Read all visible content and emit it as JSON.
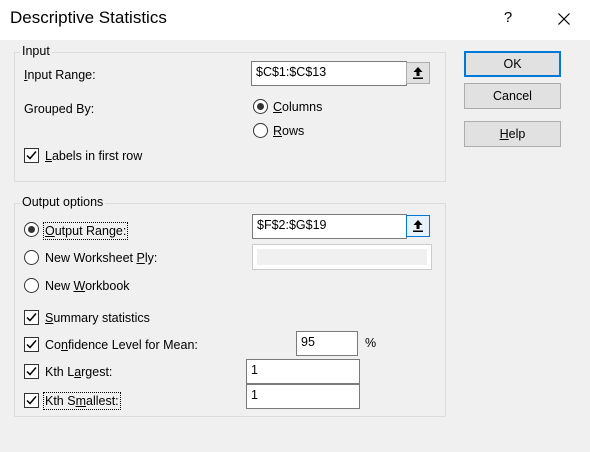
{
  "window": {
    "title": "Descriptive Statistics",
    "help_glyph": "?"
  },
  "input_group": {
    "legend": "Input",
    "input_range": {
      "label_pre": "",
      "label_ul": "I",
      "label_post": "nput Range:",
      "value": "$C$1:$C$13"
    },
    "grouped_by": {
      "label": "Grouped By:"
    },
    "columns": {
      "label_ul": "C",
      "label_post": "olumns",
      "selected": true
    },
    "rows": {
      "label_ul": "R",
      "label_post": "ows",
      "selected": false
    },
    "labels_first_row": {
      "label_ul": "L",
      "label_post": "abels in first row",
      "checked": true
    }
  },
  "output_group": {
    "legend": "Output options",
    "output_range": {
      "label_ul": "O",
      "label_post": "utput Range:",
      "value": "$F$2:$G$19",
      "selected": true
    },
    "new_worksheet": {
      "label_pre": "New Worksheet ",
      "label_ul": "P",
      "label_post": "ly:",
      "selected": false,
      "value": ""
    },
    "new_workbook": {
      "label_pre": "New ",
      "label_ul": "W",
      "label_post": "orkbook",
      "selected": false
    },
    "summary_statistics": {
      "label_ul": "S",
      "label_post": "ummary statistics",
      "checked": true
    },
    "confidence_level": {
      "label_pre": "Co",
      "label_ul": "n",
      "label_post": "fidence Level for Mean:",
      "checked": true,
      "value": "95",
      "unit": "%"
    },
    "kth_largest": {
      "label_pre": "Kth L",
      "label_ul": "a",
      "label_post": "rgest:",
      "checked": true,
      "value": "1"
    },
    "kth_smallest": {
      "label_pre": "Kth S",
      "label_ul": "m",
      "label_post": "allest:",
      "checked": true,
      "value": "1"
    }
  },
  "buttons": {
    "ok": "OK",
    "cancel": "Cancel",
    "help_ul": "H",
    "help_post": "elp"
  },
  "colors": {
    "accent": "#0078d7",
    "dialog_bg": "#f0f0f0"
  }
}
